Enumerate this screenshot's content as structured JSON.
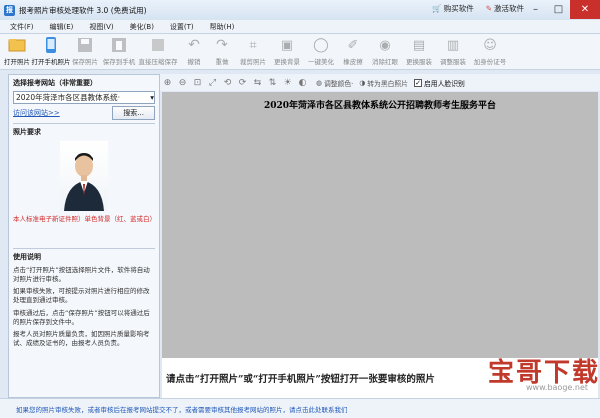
{
  "window": {
    "title": "报考照片审核处理软件 3.0 (免费试用)",
    "buy": "购买软件",
    "activate": "激活软件"
  },
  "menu": [
    "文件(F)",
    "编辑(E)",
    "视图(V)",
    "美化(B)",
    "设置(T)",
    "帮助(H)"
  ],
  "toolbar": [
    {
      "label": "打开照片",
      "icon": "folder-open-icon",
      "enabled": true
    },
    {
      "label": "打开手机照片",
      "icon": "phone-icon",
      "enabled": true
    },
    {
      "label": "保存照片",
      "icon": "save-icon",
      "enabled": false
    },
    {
      "label": "保存到手机",
      "icon": "save-phone-icon",
      "enabled": false
    },
    {
      "label": "直接压缩保存",
      "icon": "compress-save-icon",
      "enabled": false
    },
    {
      "label": "撤销",
      "icon": "undo-icon",
      "enabled": false
    },
    {
      "label": "重做",
      "icon": "redo-icon",
      "enabled": false
    },
    {
      "label": "裁剪照片",
      "icon": "crop-icon",
      "enabled": false
    },
    {
      "label": "更换背景",
      "icon": "change-background-icon",
      "enabled": false
    },
    {
      "label": "一键美化",
      "icon": "beautify-icon",
      "enabled": false
    },
    {
      "label": "橡皮擦",
      "icon": "eraser-icon",
      "enabled": false
    },
    {
      "label": "消除红眼",
      "icon": "red-eye-icon",
      "enabled": false
    },
    {
      "label": "更换服装",
      "icon": "change-clothes-icon",
      "enabled": false
    },
    {
      "label": "调整服装",
      "icon": "adjust-clothes-icon",
      "enabled": false
    },
    {
      "label": "加身份证号",
      "icon": "add-id-icon",
      "enabled": false
    }
  ],
  "left": {
    "site_heading": "选择报考网站（非常重要）",
    "site_selected": "2020年菏泽市各区县教体系统·",
    "visit_link": "访问该网站>>",
    "search_button": "搜索...",
    "photo_heading": "照片要求",
    "photo_note": "本人标准电子新证件照）单色背景（红、蓝或白）",
    "usage_heading": "使用说明",
    "usage": [
      "点击“打开照片”按钮选择照片文件，软件将自动对照片进行审核。",
      "如果审核失败，可按提示对照片进行相应的修改处理直到通过审核。",
      "审核通过后，点击“保存照片”按钮可以将通过后的照片保存到文件中。",
      "报考人员对照片质量负责，如因照片质量影响考试、成绩及证书的，由报考人员负责。"
    ]
  },
  "imgbar": {
    "color_label": "调整颜色·",
    "bw_label": "转为黑白照片",
    "face_label": "启用人脸识别",
    "face_checked": "✓"
  },
  "canvas": {
    "headline": "2020年菏泽市各区县教体系统公开招聘教师考生服务平台",
    "prompt": "请点击“打开照片”或“打开手机照片”按钮打开一张要审核的照片"
  },
  "status": "如果您的照片审核失败，或者审核后在报考网站提交不了，或者需要审核其他报考网站的照片，请点击此处联系我们",
  "watermark": {
    "big": "宝哥下载",
    "small": "www.baoge.net"
  }
}
